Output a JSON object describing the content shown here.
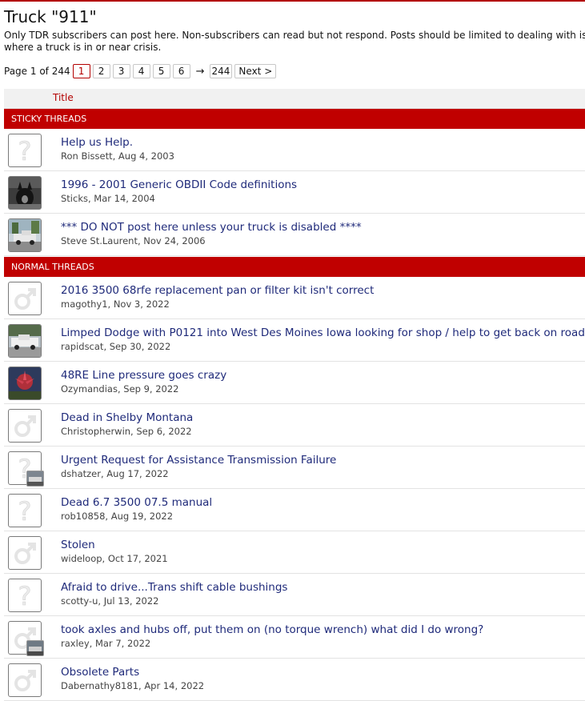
{
  "forum": {
    "title": "Truck \"911\"",
    "description": "Only TDR subscribers can post here. Non-subscribers can read but not respond. Posts should be limited to dealing with issues where a truck is in or near crisis."
  },
  "pagination": {
    "label": "Page 1 of 244",
    "pages": [
      "1",
      "2",
      "3",
      "4",
      "5",
      "6"
    ],
    "current": "1",
    "arrow": "→",
    "last": "244",
    "next": "Next >"
  },
  "table": {
    "title_header": "Title"
  },
  "sections": {
    "sticky": "STICKY THREADS",
    "normal": "NORMAL THREADS"
  },
  "sticky_threads": [
    {
      "title": "Help us Help.",
      "meta": "Ron Bissett, Aug 4, 2003",
      "avatar": "question-mark-icon"
    },
    {
      "title": "1996 - 2001 Generic OBDII Code definitions",
      "meta": "Sticks, Mar 14, 2004",
      "avatar": "dog-photo"
    },
    {
      "title": "*** DO NOT post here unless your truck is disabled ****",
      "meta": "Steve St.Laurent, Nov 24, 2006",
      "avatar": "truck-photo"
    }
  ],
  "normal_threads": [
    {
      "title": "2016 3500 68rfe replacement pan or filter kit isn't correct",
      "meta": "magothy1, Nov 3, 2022",
      "avatar": "male-symbol-icon"
    },
    {
      "title": "Limped Dodge with P0121 into West Des Moines Iowa looking for shop / help to get back on road",
      "meta": "rapidscat, Sep 30, 2022",
      "avatar": "truck-photo"
    },
    {
      "title": "48RE Line pressure goes crazy",
      "meta": "Ozymandias, Sep 9, 2022",
      "avatar": "plant-photo"
    },
    {
      "title": "Dead in Shelby Montana",
      "meta": "Christopherwin, Sep 6, 2022",
      "avatar": "male-symbol-icon"
    },
    {
      "title": "Urgent Request for Assistance Transmission Failure",
      "meta": "dshatzer, Aug 17, 2022",
      "avatar": "question-mark-icon"
    },
    {
      "title": "Dead 6.7 3500 07.5 manual",
      "meta": "rob10858, Aug 19, 2022",
      "avatar": "question-mark-icon"
    },
    {
      "title": "Stolen",
      "meta": "wideloop, Oct 17, 2021",
      "avatar": "male-symbol-icon"
    },
    {
      "title": "Afraid to drive...Trans shift cable bushings",
      "meta": "scotty-u, Jul 13, 2022",
      "avatar": "question-mark-icon"
    },
    {
      "title": "took axles and hubs off, put them on (no torque wrench) what did I do wrong?",
      "meta": "raxley, Mar 7, 2022",
      "avatar": "male-symbol-icon"
    },
    {
      "title": "Obsolete Parts",
      "meta": "Dabernathy8181, Apr 14, 2022",
      "avatar": "male-symbol-icon"
    }
  ],
  "colors": {
    "brand_red": "#c00000",
    "link_blue": "#1f2a7a"
  }
}
